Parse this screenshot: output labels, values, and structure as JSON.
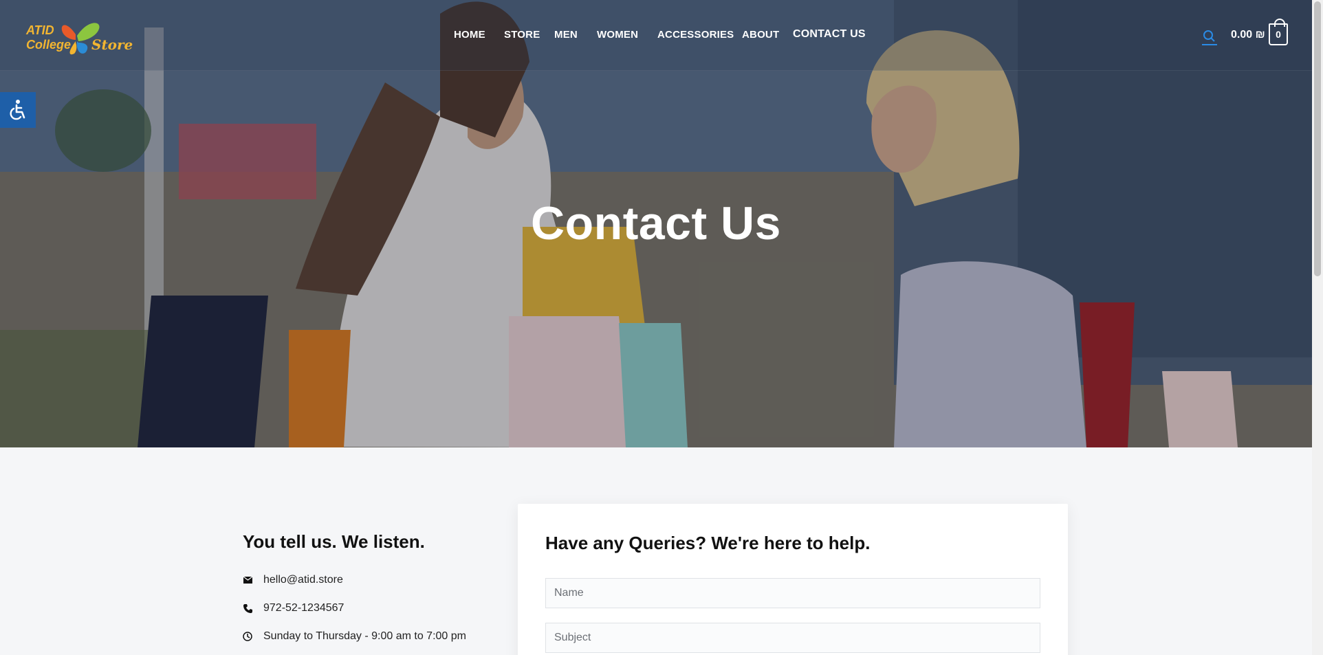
{
  "logo": {
    "line1": "ATID",
    "line2": "College",
    "line3": "Store"
  },
  "nav": {
    "items": [
      "HOME",
      "STORE",
      "MEN",
      "WOMEN",
      "ACCESSORIES",
      "ABOUT",
      "CONTACT US"
    ]
  },
  "cart": {
    "amount": "0.00 ₪",
    "count": "0"
  },
  "hero": {
    "title": "Contact Us"
  },
  "contact": {
    "heading": "You tell us. We listen.",
    "email": "hello@atid.store",
    "phone": "972-52-1234567",
    "hours": "Sunday to Thursday - 9:00 am to 7:00 pm"
  },
  "form": {
    "heading": "Have any Queries? We're here to help.",
    "name_placeholder": "Name",
    "subject_placeholder": "Subject"
  },
  "colors": {
    "logo_gold": "#f2b531",
    "accent_blue": "#1e5fa8",
    "search_blue": "#2a8be6"
  }
}
